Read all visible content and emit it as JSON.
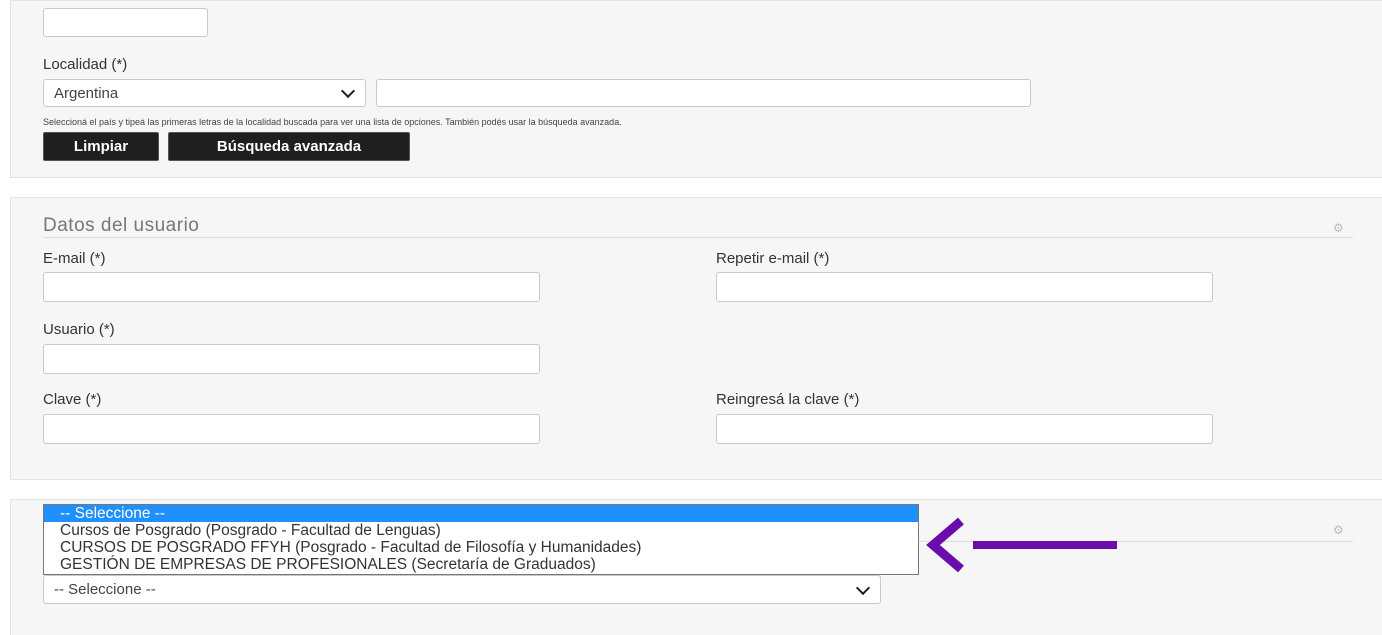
{
  "localidad": {
    "label": "Localidad (*)",
    "country_value": "Argentina",
    "search_value": "",
    "hint": "Seleccioná el país y tipeá las primeras letras de la localidad buscada para ver una lista de opciones. También podés usar la búsqueda avanzada.",
    "clear_button": "Limpiar",
    "advanced_button": "Búsqueda avanzada"
  },
  "user_section": {
    "title": "Datos del usuario",
    "email_label": "E-mail (*)",
    "email_repeat_label": "Repetir e-mail (*)",
    "username_label": "Usuario (*)",
    "password_label": "Clave (*)",
    "password_repeat_label": "Reingresá la clave (*)"
  },
  "program_select": {
    "value": "-- Seleccione --",
    "options": [
      "-- Seleccione --",
      "Cursos de Posgrado (Posgrado - Facultad de Lenguas)",
      "CURSOS DE POSGRADO FFYH (Posgrado - Facultad de Filosofía y Humanidades)",
      "GESTIÓN DE EMPRESAS DE PROFESIONALES (Secretaría de Graduados)"
    ],
    "selected_index": 0
  },
  "annotation": {
    "arrow_color": "#6a0dad"
  },
  "icons": {
    "section_gear": "gear-icon",
    "select_chevron": "chevron-down-icon"
  }
}
